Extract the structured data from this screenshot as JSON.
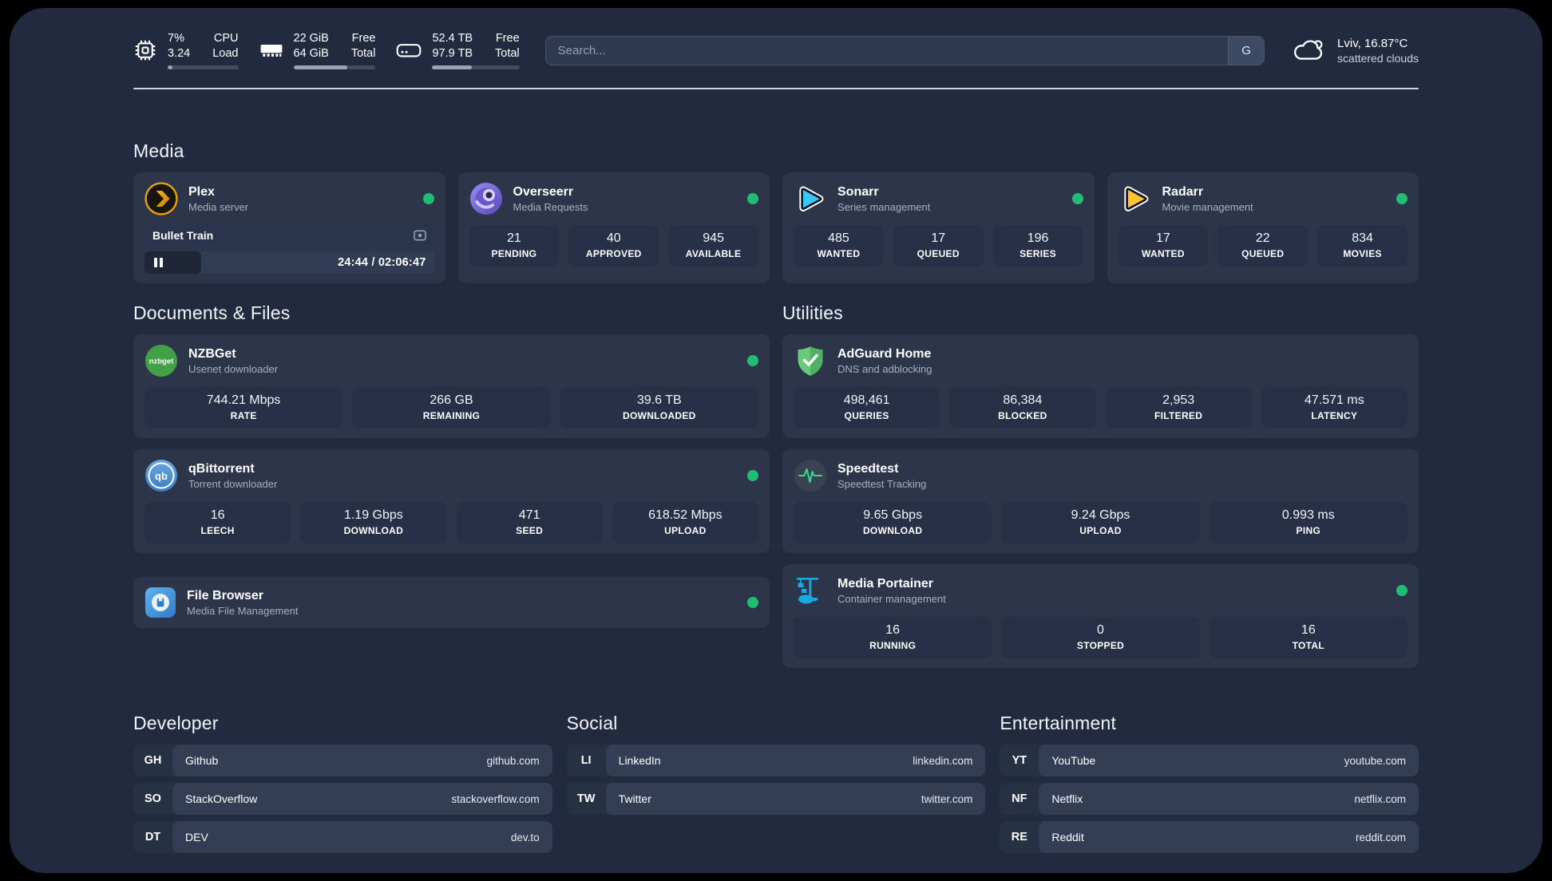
{
  "colors": {
    "status_online": "#21bd74",
    "plex_accent": "#e8a00c"
  },
  "topbar": {
    "cpu": {
      "v1": "7%",
      "v2": "3.24",
      "l1": "CPU",
      "l2": "Load",
      "progress": 7
    },
    "ram": {
      "v1": "22 GiB",
      "v2": "64 GiB",
      "l1": "Free",
      "l2": "Total",
      "progress": 66
    },
    "disk": {
      "v1": "52.4 TB",
      "v2": "97.9 TB",
      "l1": "Free",
      "l2": "Total",
      "progress": 45
    },
    "search": {
      "placeholder": "Search...",
      "provider_label": "G"
    },
    "weather": {
      "location": "Lviv, 16.87°C",
      "condition": "scattered clouds"
    }
  },
  "media": {
    "heading": "Media",
    "plex": {
      "name": "Plex",
      "subtitle": "Media server",
      "now_playing": "Bullet Train",
      "time": "24:44 / 02:06:47",
      "progress": 19.5
    },
    "overseerr": {
      "name": "Overseerr",
      "subtitle": "Media Requests",
      "stats": [
        {
          "v": "21",
          "l": "PENDING"
        },
        {
          "v": "40",
          "l": "APPROVED"
        },
        {
          "v": "945",
          "l": "AVAILABLE"
        }
      ]
    },
    "sonarr": {
      "name": "Sonarr",
      "subtitle": "Series management",
      "stats": [
        {
          "v": "485",
          "l": "WANTED"
        },
        {
          "v": "17",
          "l": "QUEUED"
        },
        {
          "v": "196",
          "l": "SERIES"
        }
      ]
    },
    "radarr": {
      "name": "Radarr",
      "subtitle": "Movie management",
      "stats": [
        {
          "v": "17",
          "l": "WANTED"
        },
        {
          "v": "22",
          "l": "QUEUED"
        },
        {
          "v": "834",
          "l": "MOVIES"
        }
      ]
    }
  },
  "documents": {
    "heading": "Documents & Files",
    "nzbget": {
      "name": "NZBGet",
      "subtitle": "Usenet downloader",
      "badge": "nzbget",
      "stats": [
        {
          "v": "744.21 Mbps",
          "l": "RATE"
        },
        {
          "v": "266 GB",
          "l": "REMAINING"
        },
        {
          "v": "39.6 TB",
          "l": "DOWNLOADED"
        }
      ]
    },
    "qbittorrent": {
      "name": "qBittorrent",
      "subtitle": "Torrent downloader",
      "badge": "qb",
      "stats": [
        {
          "v": "16",
          "l": "LEECH"
        },
        {
          "v": "1.19 Gbps",
          "l": "DOWNLOAD"
        },
        {
          "v": "471",
          "l": "SEED"
        },
        {
          "v": "618.52 Mbps",
          "l": "UPLOAD"
        }
      ]
    },
    "filebrowser": {
      "name": "File Browser",
      "subtitle": "Media File Management"
    }
  },
  "utilities": {
    "heading": "Utilities",
    "adguard": {
      "name": "AdGuard Home",
      "subtitle": "DNS and adblocking",
      "stats": [
        {
          "v": "498,461",
          "l": "QUERIES"
        },
        {
          "v": "86,384",
          "l": "BLOCKED"
        },
        {
          "v": "2,953",
          "l": "FILTERED"
        },
        {
          "v": "47.571 ms",
          "l": "LATENCY"
        }
      ]
    },
    "speedtest": {
      "name": "Speedtest",
      "subtitle": "Speedtest Tracking",
      "stats": [
        {
          "v": "9.65 Gbps",
          "l": "DOWNLOAD"
        },
        {
          "v": "9.24 Gbps",
          "l": "UPLOAD"
        },
        {
          "v": "0.993 ms",
          "l": "PING"
        }
      ]
    },
    "portainer": {
      "name": "Media Portainer",
      "subtitle": "Container management",
      "stats": [
        {
          "v": "16",
          "l": "RUNNING"
        },
        {
          "v": "0",
          "l": "STOPPED"
        },
        {
          "v": "16",
          "l": "TOTAL"
        }
      ]
    }
  },
  "bookmarks": {
    "developer": {
      "heading": "Developer",
      "items": [
        {
          "abbr": "GH",
          "name": "Github",
          "url": "github.com"
        },
        {
          "abbr": "SO",
          "name": "StackOverflow",
          "url": "stackoverflow.com"
        },
        {
          "abbr": "DT",
          "name": "DEV",
          "url": "dev.to"
        }
      ]
    },
    "social": {
      "heading": "Social",
      "items": [
        {
          "abbr": "LI",
          "name": "LinkedIn",
          "url": "linkedin.com"
        },
        {
          "abbr": "TW",
          "name": "Twitter",
          "url": "twitter.com"
        }
      ]
    },
    "entertainment": {
      "heading": "Entertainment",
      "items": [
        {
          "abbr": "YT",
          "name": "YouTube",
          "url": "youtube.com"
        },
        {
          "abbr": "NF",
          "name": "Netflix",
          "url": "netflix.com"
        },
        {
          "abbr": "RE",
          "name": "Reddit",
          "url": "reddit.com"
        }
      ]
    }
  }
}
